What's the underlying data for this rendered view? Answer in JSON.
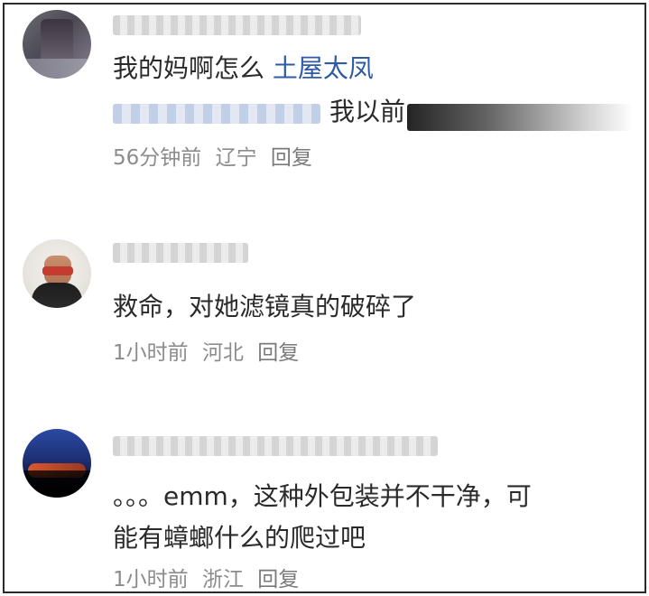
{
  "comments": [
    {
      "body_line1_prefix": "我的妈啊怎么",
      "body_line1_link": "土屋太凤",
      "body_line2_text": "我以前",
      "meta": {
        "time": "56分钟前",
        "location": "辽宁",
        "reply": "回复"
      }
    },
    {
      "body_line1": "救命，对她滤镜真的破碎了",
      "meta": {
        "time": "1小时前",
        "location": "河北",
        "reply": "回复"
      }
    },
    {
      "body_line1": "。。。emm，这种外包装并不干净，可",
      "body_line2": "能有蟑螂什么的爬过吧",
      "meta": {
        "time": "1小时前",
        "location": "浙江",
        "reply": "回复"
      }
    }
  ],
  "icons": {
    "avatar_1": "avatar-icon",
    "avatar_2": "avatar-icon",
    "avatar_3": "avatar-icon"
  },
  "colors": {
    "link": "#2f5aa6",
    "text": "#2a2a2a",
    "meta": "#8c8c8c",
    "border": "#2b2b2b"
  }
}
